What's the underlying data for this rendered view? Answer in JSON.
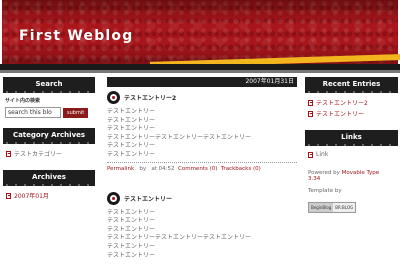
{
  "header": {
    "title": "First Weblog"
  },
  "left": {
    "search": {
      "heading": "Search",
      "label": "サイト内の検索",
      "value": "search this blo",
      "submit_label": "submit"
    },
    "category": {
      "heading": "Category Archives",
      "item": "テストカテゴリー"
    },
    "archives": {
      "heading": "Archives",
      "item": "2007年01月"
    }
  },
  "main": {
    "date": "2007年01月31日",
    "entries": [
      {
        "title": "テストエントリー2",
        "lines": [
          "テストエントリー",
          "テストエントリー",
          "テストエントリー",
          "テストエントリーテストエントリーテストエントリー",
          "テストエントリー",
          "テストエントリー"
        ],
        "permalink": "Permalink",
        "by": "by",
        "at": "at 04:52",
        "comments": "Comments (0)",
        "trackbacks": "Trackbacks (0)"
      },
      {
        "title": "テストエントリー",
        "lines": [
          "テストエントリー",
          "テストエントリー",
          "テストエントリー",
          "テストエントリーテストエントリーテストエントリー",
          "テストエントリー",
          "テストエントリー"
        ]
      }
    ]
  },
  "right": {
    "recent": {
      "heading": "Recent Entries",
      "items": [
        "テストエントリー2",
        "テストエントリー"
      ]
    },
    "links": {
      "heading": "Links",
      "item": "Link"
    },
    "powered": {
      "prefix": "Powered by",
      "name": "Movable Type",
      "version": "3.34"
    },
    "template": {
      "label": "Template by",
      "badge_left": "BeginBlog",
      "badge_right": "BR:BLOG"
    }
  },
  "colors": {
    "accent": "#a0141a",
    "header_red": "#a8151a",
    "dark": "#1e1e1e",
    "yellow": "#f2b51e"
  },
  "icons": {
    "entry": "target-icon",
    "link": "document-icon"
  }
}
